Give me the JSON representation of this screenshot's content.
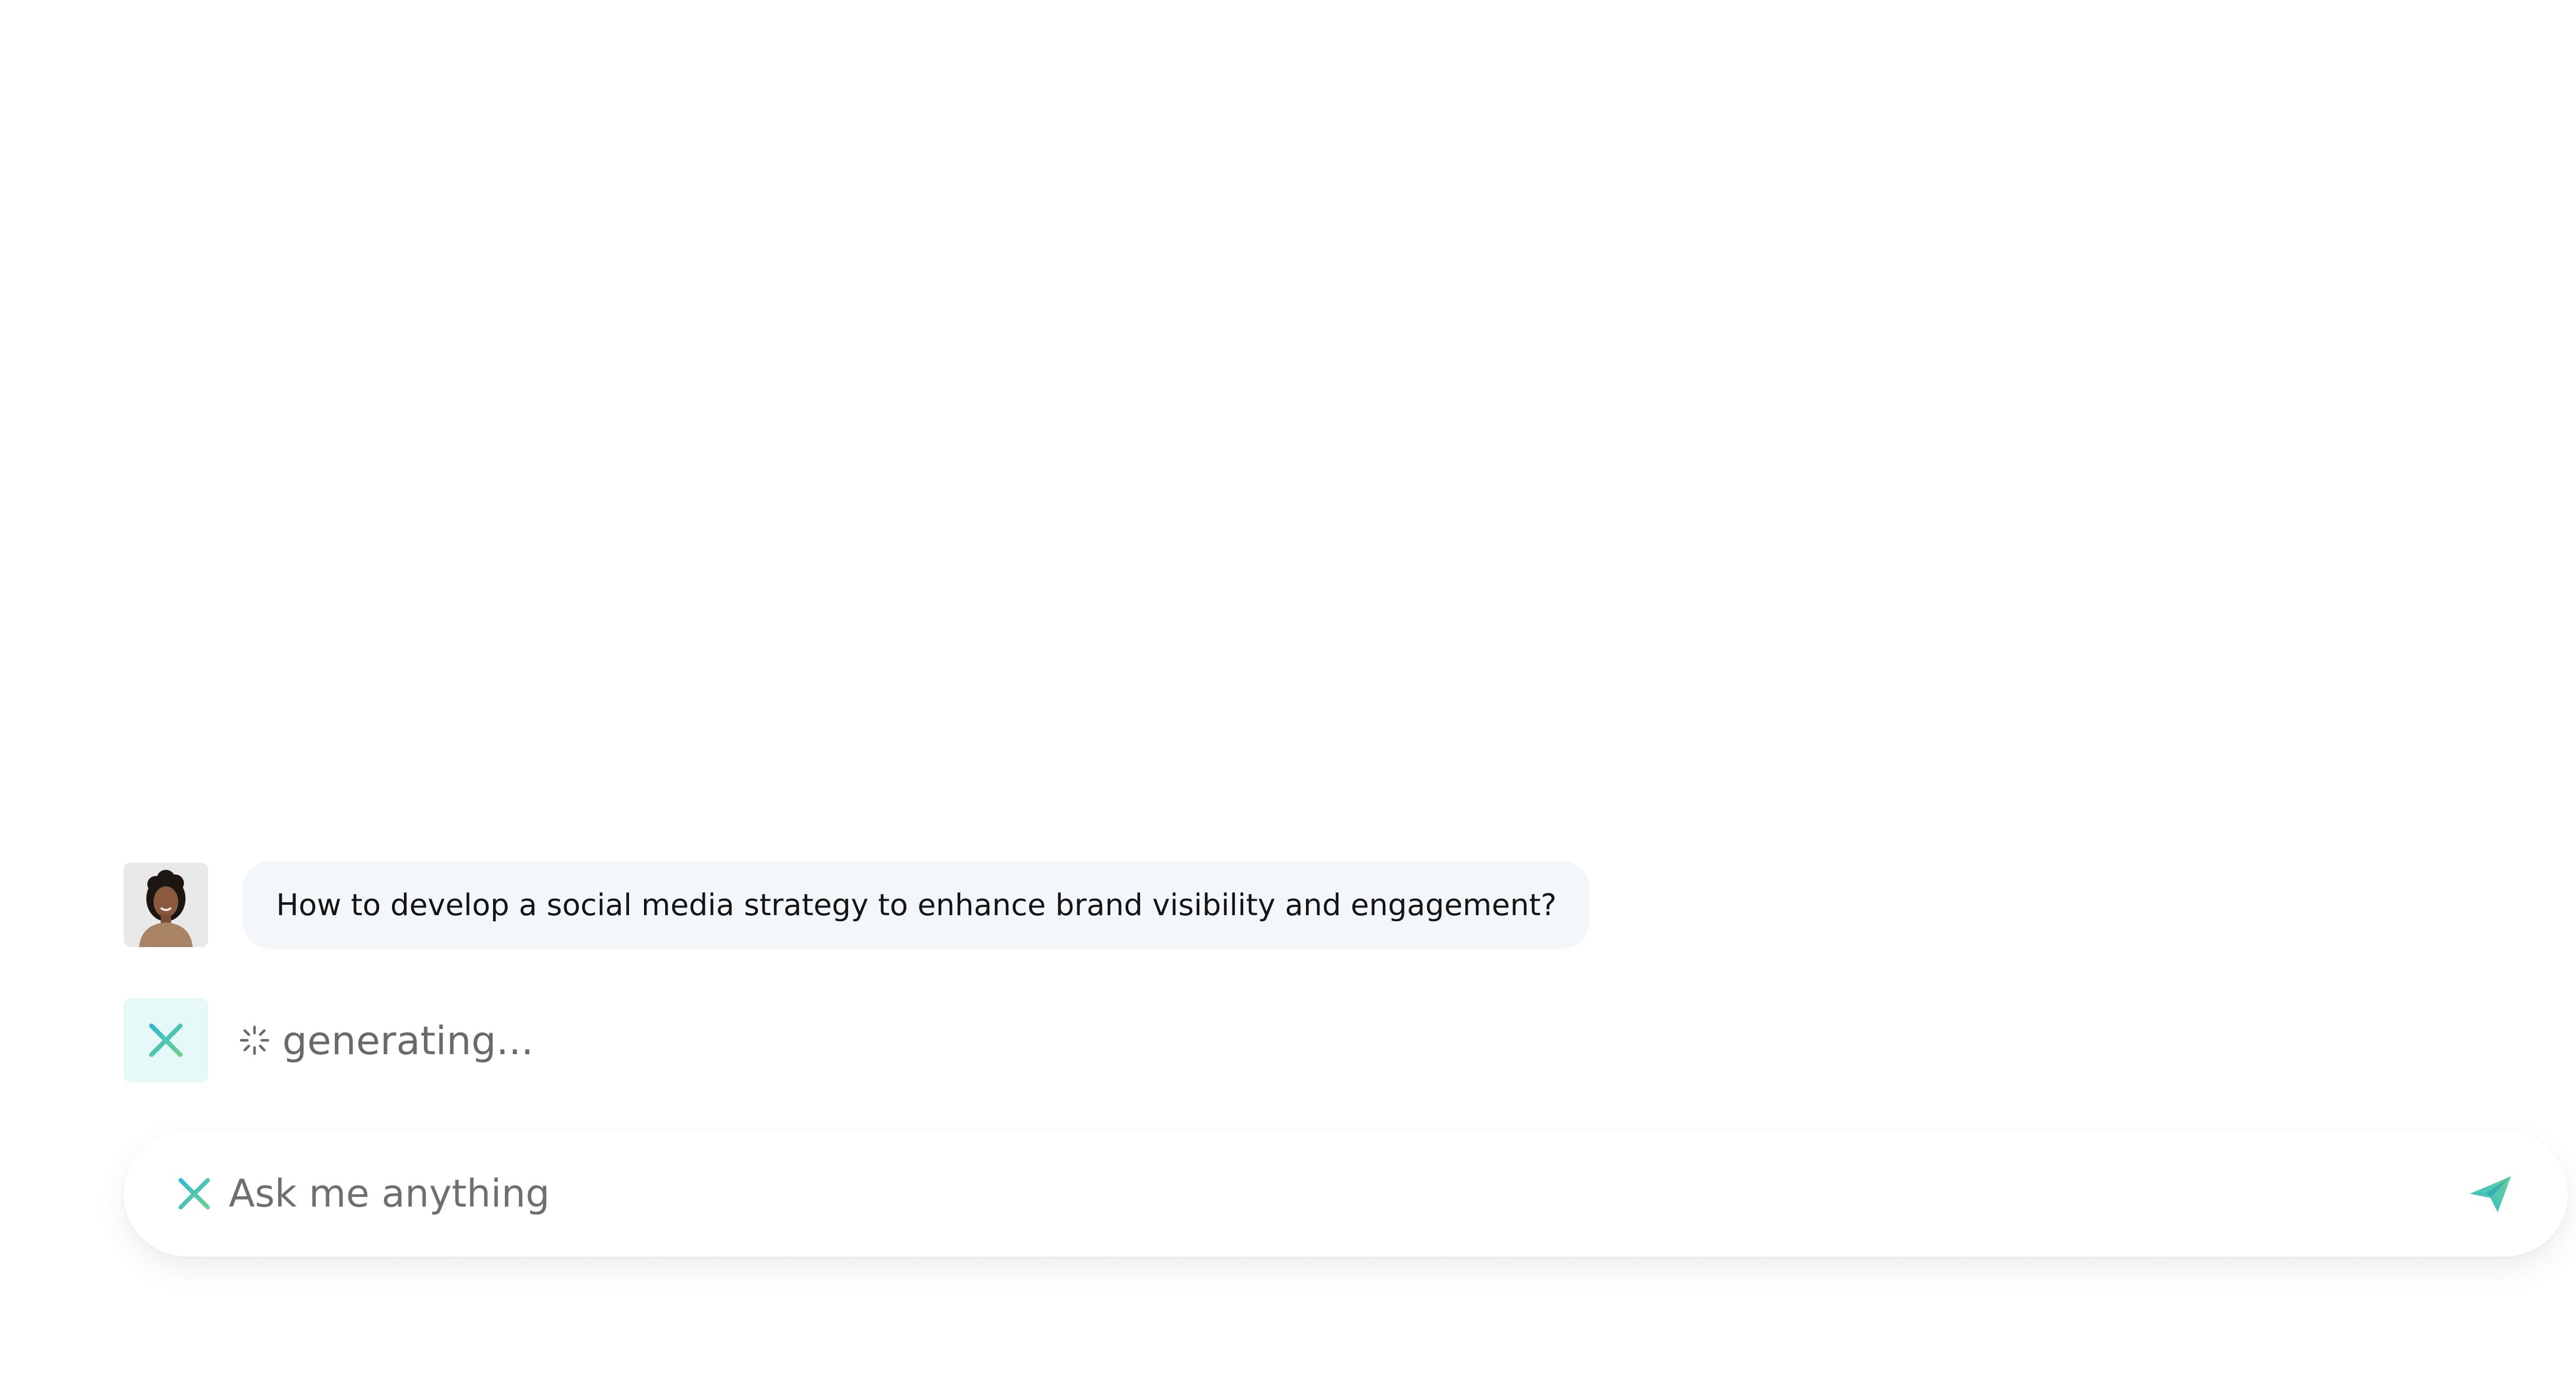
{
  "conversation": {
    "user_message": "How to develop a social media strategy to enhance brand visibility and engagement?",
    "assistant_status": "generating..."
  },
  "composer": {
    "placeholder": "Ask me anything"
  },
  "icons": {
    "assistant": "sparkle-asterisk-icon",
    "spinner": "loading-spinner-icon",
    "send": "paper-plane-send-icon"
  },
  "colors": {
    "accent_start": "#2fb8d6",
    "accent_end": "#6fd18f",
    "bubble_bg": "#f3f7fa",
    "assistant_avatar_bg": "#e7f8f8"
  }
}
